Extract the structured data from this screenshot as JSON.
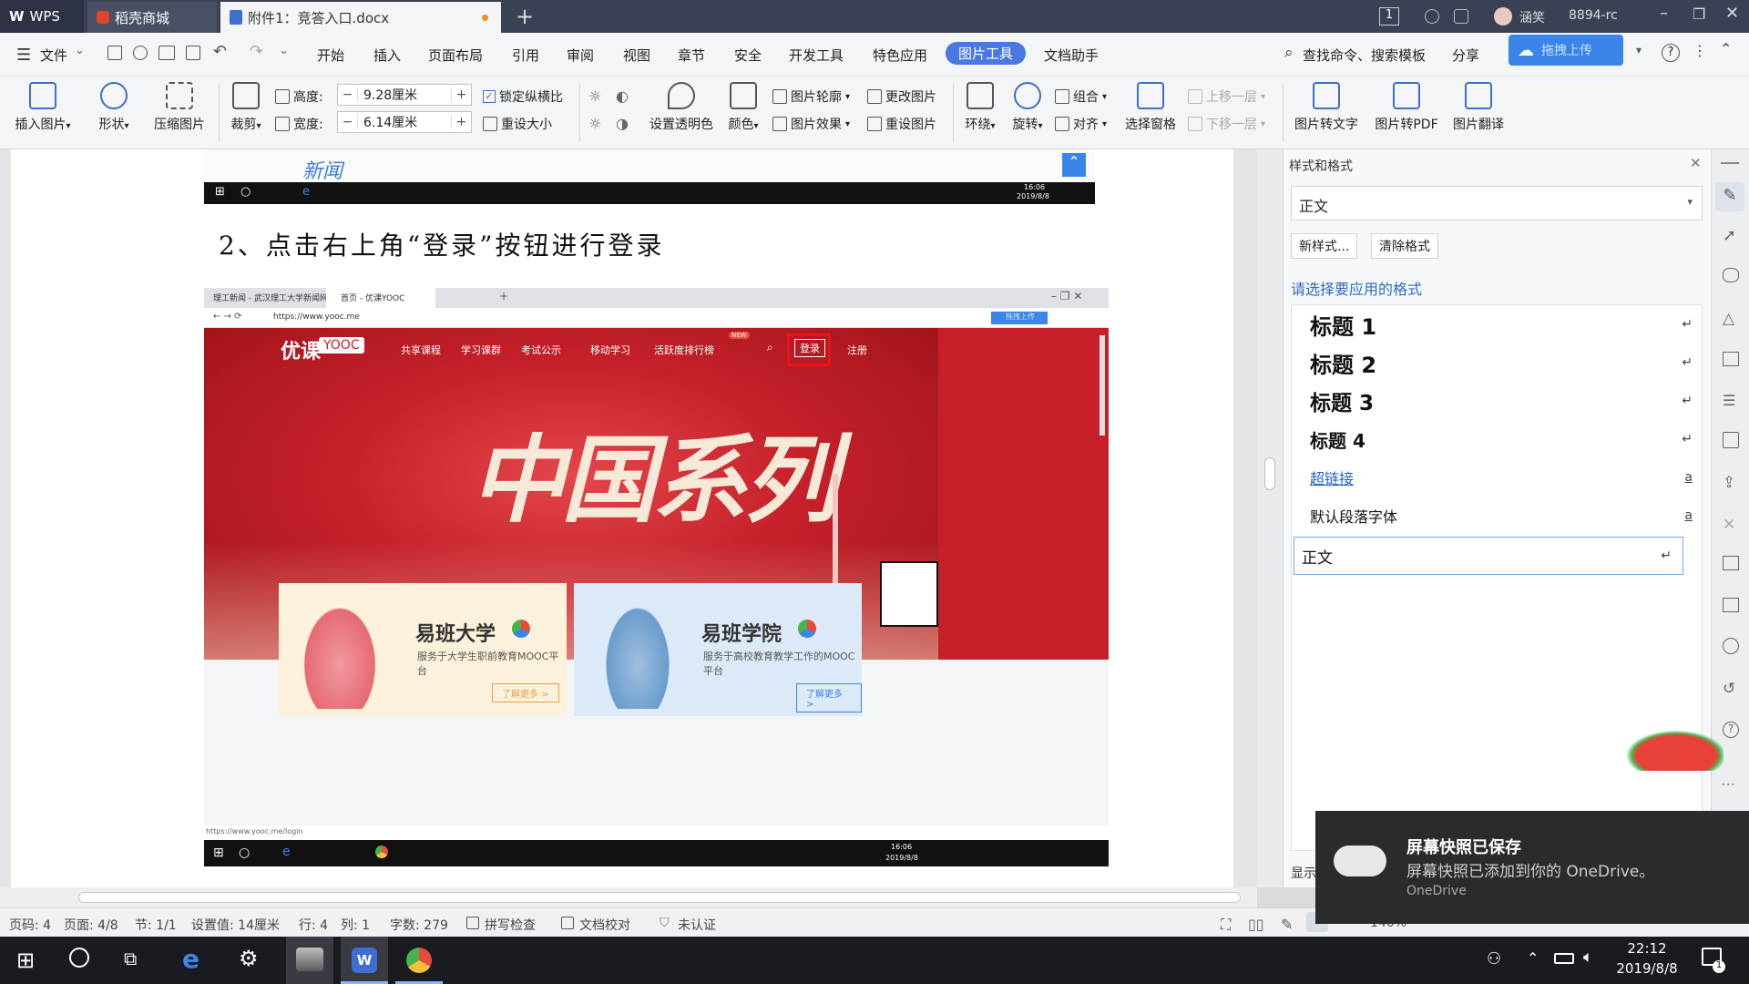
{
  "titlebar": {
    "wps": "WPS",
    "tab_store": "稻壳商城",
    "tab_doc": "附件1：竞答入口.docx",
    "page_indicator": "1",
    "user": "涵笑",
    "account": "8894-rc"
  },
  "menubar": {
    "file": "文件",
    "items": [
      "开始",
      "插入",
      "页面布局",
      "引用",
      "审阅",
      "视图",
      "章节",
      "安全",
      "开发工具",
      "特色应用",
      "图片工具",
      "文档助手"
    ],
    "search": "查找命令、搜索模板",
    "share": "分享",
    "upload_badge": "拖拽上传"
  },
  "ribbon": {
    "insert_pic": "插入图片",
    "shape": "形状",
    "compress": "压缩图片",
    "crop": "裁剪",
    "height_label": "高度:",
    "height_value": "9.28厘米",
    "width_label": "宽度:",
    "width_value": "6.14厘米",
    "lock_ratio": "锁定纵横比",
    "reset_size": "重设大小",
    "transparent": "设置透明色",
    "color": "颜色",
    "pic_outline": "图片轮廓",
    "pic_effect": "图片效果",
    "change_pic": "更改图片",
    "reset_pic": "重设图片",
    "wrap": "环绕",
    "rotate": "旋转",
    "group": "组合",
    "align": "对齐",
    "select_pane": "选择窗格",
    "move_up": "上移一层",
    "move_down": "下移一层",
    "pic_to_text": "图片转文字",
    "pic_to_pdf": "图片转PDF",
    "pic_translate": "图片翻译"
  },
  "document": {
    "heading": "2、点击右上角“登录”按钮进行登录",
    "top_logo": "新闻",
    "taskbar_time_small": "16:06",
    "taskbar_date_small": "2019/8/8"
  },
  "screenshot": {
    "tab1": "理工新闻 - 武汉理工大学新闻网",
    "tab2": "首页 - 优课YOOC",
    "url": "https://www.yooc.me",
    "logo": "优课",
    "logo_box": "YOOC",
    "nav": [
      "共享课程",
      "学习课群",
      "考试公示",
      "移动学习",
      "活跃度排行榜"
    ],
    "new_badge": "NEW",
    "login": "登录",
    "register": "注册",
    "banner_text": "中国系列",
    "card1_title": "易班大学",
    "card1_sub": "服务于大学生职前教育MOOC平台",
    "card1_btn": "了解更多 >",
    "card2_title": "易班学院",
    "card2_sub": "服务于高校教育教学工作的MOOC平台",
    "card2_btn": "了解更多 >",
    "status_url": "https://www.yooc.me/login",
    "upload": "拖拽上传"
  },
  "stylepanel": {
    "title": "样式和格式",
    "current": "正文",
    "new_style": "新样式...",
    "clear_format": "清除格式",
    "choose_label": "请选择要应用的格式",
    "styles": [
      "标题 1",
      "标题 2",
      "标题 3",
      "标题 4"
    ],
    "hyperlink": "超链接",
    "default_font": "默认段落字体",
    "body": "正文",
    "show_label": "显示"
  },
  "statusbar": {
    "page_code": "页码: 4",
    "page": "页面: 4/8",
    "section": "节: 1/1",
    "setting": "设置值: 14厘米",
    "row": "行: 4",
    "col": "列: 1",
    "words": "字数: 279",
    "spell": "拼写检查",
    "proof": "文档校对",
    "cert": "未认证",
    "zoom": "140%"
  },
  "taskbar": {
    "time": "22:12",
    "date": "2019/8/8",
    "notif_count": "1"
  },
  "toast": {
    "title": "屏幕快照已保存",
    "body": "屏幕快照已添加到你的 OneDrive。",
    "source": "OneDrive"
  }
}
